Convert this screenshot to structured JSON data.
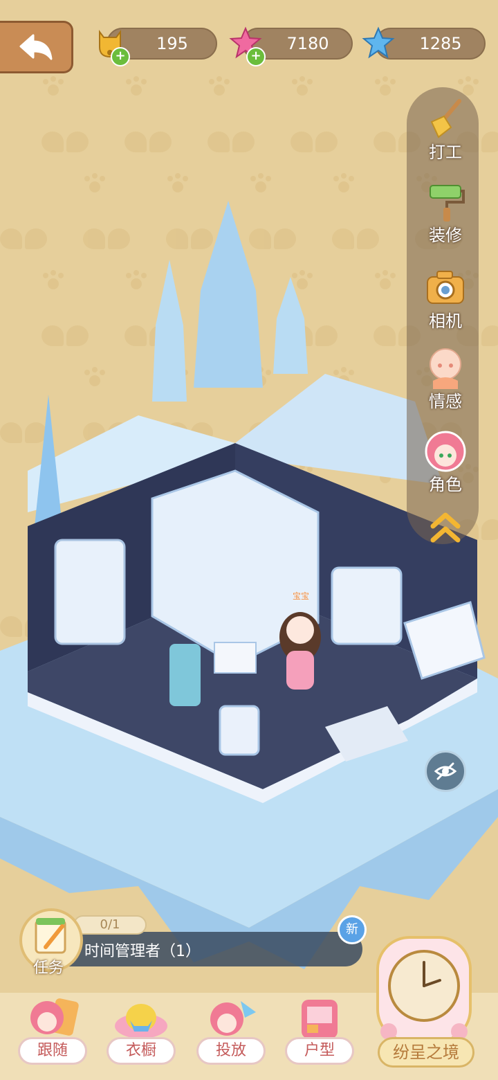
{
  "currencies": [
    {
      "name": "bell-icon",
      "value": "195"
    },
    {
      "name": "pink-gem-icon",
      "value": "7180"
    },
    {
      "name": "snowflake-gem-icon",
      "value": "1285"
    }
  ],
  "side_menu": {
    "items": [
      {
        "label": "打工",
        "icon": "broom-icon"
      },
      {
        "label": "装修",
        "icon": "paint-roller-icon"
      },
      {
        "label": "相机",
        "icon": "camera-icon"
      },
      {
        "label": "情感",
        "icon": "face-icon"
      },
      {
        "label": "角色",
        "icon": "character-avatar-icon"
      }
    ]
  },
  "scene": {
    "character_name": "宝宝"
  },
  "task": {
    "label": "任务",
    "progress": "0/1",
    "text": "时间管理者（1）",
    "badge": "新"
  },
  "bottom_nav": {
    "items": [
      {
        "label": "跟随"
      },
      {
        "label": "衣橱"
      },
      {
        "label": "投放"
      },
      {
        "label": "户型"
      }
    ],
    "world_label": "纷呈之境"
  },
  "colors": {
    "background": "#e6cf9b",
    "ice": "#bfe0f5",
    "floor": "#3e4767",
    "bottom_label_text": "#c45a5a"
  }
}
